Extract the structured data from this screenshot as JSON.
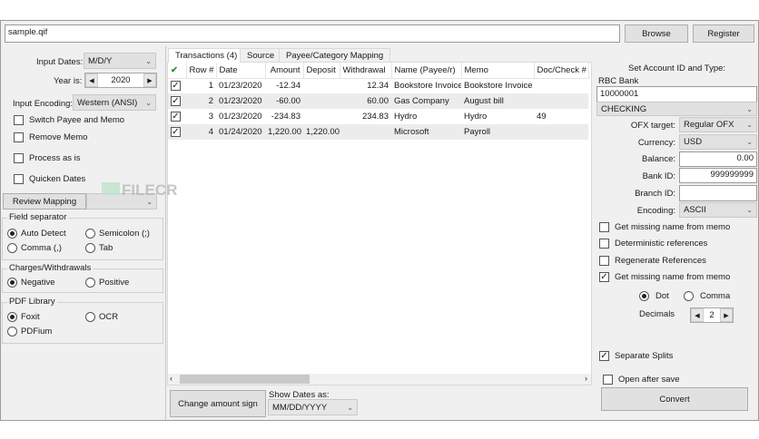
{
  "top": {
    "file_value": "sample.qif",
    "browse": "Browse",
    "register": "Register"
  },
  "left": {
    "input_dates_label": "Input Dates:",
    "input_dates_value": "M/D/Y",
    "year_label": "Year is:",
    "year_value": "2020",
    "encoding_label": "Input Encoding:",
    "encoding_value": "Western (ANSI)",
    "checks": [
      {
        "label": "Switch Payee and Memo",
        "checked": false
      },
      {
        "label": "Remove Memo",
        "checked": false
      },
      {
        "label": "Process as is",
        "checked": false
      },
      {
        "label": "Quicken Dates",
        "checked": false
      }
    ],
    "review_mapping": "Review Mapping",
    "field_separator": {
      "title": "Field separator",
      "options": [
        "Auto Detect",
        "Semicolon (;)",
        "Comma (,)",
        "Tab"
      ],
      "selected": "Auto Detect"
    },
    "charges": {
      "title": "Charges/Withdrawals",
      "options": [
        "Negative",
        "Positive"
      ],
      "selected": "Negative"
    },
    "pdf": {
      "title": "PDF Library",
      "options": [
        "Foxit",
        "OCR",
        "PDFium"
      ],
      "selected": "Foxit"
    }
  },
  "tabs": [
    "Transactions (4)",
    "Source",
    "Payee/Category Mapping"
  ],
  "table": {
    "headers": [
      "Row #",
      "Date",
      "Amount",
      "Deposit",
      "Withdrawal",
      "Name (Payee/r)",
      "Memo",
      "Doc/Check #"
    ],
    "rows": [
      [
        "1",
        "01/23/2020",
        "-12.34",
        "",
        "12.34",
        "Bookstore Invoice",
        "Bookstore Invoice",
        ""
      ],
      [
        "2",
        "01/23/2020",
        "-60.00",
        "",
        "60.00",
        "Gas Company",
        "August bill",
        ""
      ],
      [
        "3",
        "01/23/2020",
        "-234.83",
        "",
        "234.83",
        "Hydro",
        "Hydro",
        "49"
      ],
      [
        "4",
        "01/24/2020",
        "1,220.00",
        "1,220.00",
        "",
        "Microsoft",
        "Payroll",
        ""
      ]
    ]
  },
  "bottom": {
    "change_sign": "Change amount sign",
    "show_dates_label": "Show Dates as:",
    "show_dates_value": "MM/DD/YYYY"
  },
  "right": {
    "title": "Set Account ID and Type:",
    "bank_name": "RBC Bank",
    "account_id": "10000001",
    "account_type": "CHECKING",
    "ofx_label": "OFX target:",
    "ofx_value": "Regular OFX",
    "currency_label": "Currency:",
    "currency_value": "USD",
    "balance_label": "Balance:",
    "balance_value": "0.00",
    "bankid_label": "Bank ID:",
    "bankid_value": "999999999",
    "branch_label": "Branch ID:",
    "branch_value": "",
    "encoding_label": "Encoding:",
    "encoding_value": "ASCII",
    "checks": [
      {
        "label": "Get missing name from memo",
        "checked": false
      },
      {
        "label": "Deterministic references",
        "checked": false
      },
      {
        "label": "Regenerate References",
        "checked": false
      },
      {
        "label": "Get missing name from memo",
        "checked": true
      }
    ],
    "decimal_options": [
      "Dot",
      "Comma"
    ],
    "decimal_selected": "Dot",
    "decimals_label": "Decimals",
    "decimals_value": "2",
    "separate_splits": "Separate Splits",
    "open_after_save": "Open after save",
    "convert": "Convert"
  },
  "watermark": "FILECR"
}
